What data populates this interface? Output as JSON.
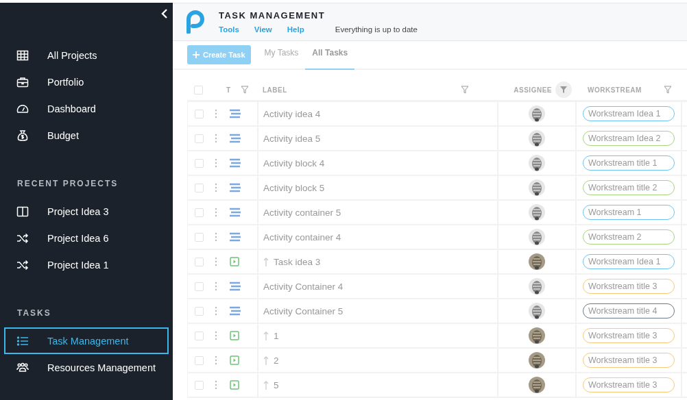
{
  "sidebar": {
    "sections": [
      {
        "items": [
          {
            "label": "All Projects",
            "selected": false
          },
          {
            "label": "Portfolio",
            "selected": false
          },
          {
            "label": "Dashboard",
            "selected": false
          },
          {
            "label": "Budget",
            "selected": false
          }
        ]
      },
      {
        "title": "RECENT PROJECTS",
        "items": [
          {
            "label": "Project Idea 3",
            "selected": false
          },
          {
            "label": "Project Idea 6",
            "selected": false
          },
          {
            "label": "Project Idea 1",
            "selected": false
          }
        ]
      },
      {
        "title": "TASKS",
        "items": [
          {
            "label": "Task Management",
            "selected": true
          },
          {
            "label": "Resources Management",
            "selected": false
          }
        ]
      }
    ]
  },
  "header": {
    "title": "TASK MANAGEMENT",
    "menu": [
      "Tools",
      "View",
      "Help"
    ],
    "status": "Everything is up to date"
  },
  "toolbar": {
    "create_button": "Create Task",
    "tabs": [
      {
        "label": "My Tasks",
        "selected": false
      },
      {
        "label": "All Tasks",
        "selected": true
      }
    ]
  },
  "table": {
    "select_all_checked": false,
    "columns": {
      "type": "T",
      "label": "LABEL",
      "assignee": "ASSIGNEE",
      "workstream": "WORKSTREAM"
    },
    "rows": [
      {
        "kind": "activity",
        "checked": false,
        "label": "Activity idea 4",
        "workstream": "Workstream Idea 1",
        "color": "#6cc4f5"
      },
      {
        "kind": "activity",
        "checked": false,
        "label": "Activity idea 5",
        "workstream": "Workstream Idea 2",
        "color": "#a8d37f"
      },
      {
        "kind": "activity",
        "checked": false,
        "label": "Activity block 4",
        "workstream": "Workstream title 1",
        "color": "#6cc4f5"
      },
      {
        "kind": "activity",
        "checked": false,
        "label": "Activity block 5",
        "workstream": "Workstream title 2",
        "color": "#a8d37f"
      },
      {
        "kind": "activity",
        "checked": false,
        "label": "Activity container 5",
        "workstream": "Workstream 1",
        "color": "#6cc4f5"
      },
      {
        "kind": "activity",
        "checked": false,
        "label": "Activity container 4",
        "workstream": "Workstream 2",
        "color": "#a8d37f"
      },
      {
        "kind": "task",
        "checked": false,
        "label": "Task idea 3",
        "workstream": "Workstream Idea 1",
        "color": "#6cc4f5"
      },
      {
        "kind": "activity",
        "checked": false,
        "label": "Activity Container 4",
        "workstream": "Workstream title 3",
        "color": "#f7c97a"
      },
      {
        "kind": "activity",
        "checked": false,
        "label": "Activity Container 5",
        "workstream": "Workstream title 4",
        "color": "#6a7a8a"
      },
      {
        "kind": "task",
        "checked": false,
        "label": "1",
        "workstream": "Workstream title 3",
        "color": "#f7c97a"
      },
      {
        "kind": "task",
        "checked": false,
        "label": "2",
        "workstream": "Workstream title 3",
        "color": "#f7c97a"
      },
      {
        "kind": "task",
        "checked": false,
        "label": "5",
        "workstream": "Workstream title 3",
        "color": "#f7c97a"
      }
    ]
  }
}
